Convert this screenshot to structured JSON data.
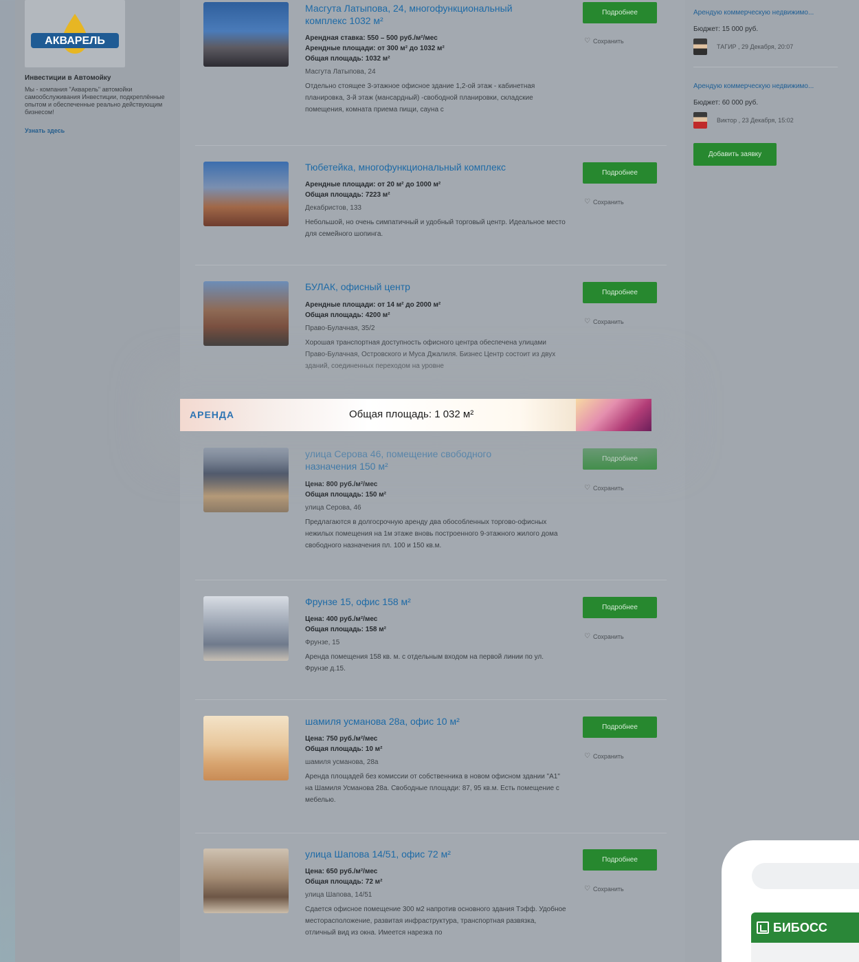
{
  "sidebar": {
    "logo_text": "АКВАРЕЛЬ",
    "promo_title": "Инвестиции в Автомойку",
    "promo_text": "Мы - компания \"Акварель\" автомойки самообслуживания Инвестиции, подкреплённые опытом и обеспеченные реально действующим бизнесом!",
    "promo_link": "Узнать здесь"
  },
  "listings": [
    {
      "title": "Масгута Латыпова, 24, многофункциональный комплекс 1032 м²",
      "facts": [
        "Арендная ставка: 550 – 500 руб./м²/мес",
        "Арендные площади: от 300 м² до 1032 м²",
        "Общая площадь: 1032 м²"
      ],
      "address": "Масгута Латыпова, 24",
      "description": "Отдельно стоящее 3-этажное офисное здание 1,2-ой этаж - кабинетная планировка, 3-й этаж (мансардный) -свободной планировки, складские помещения, комната приема пищи, сауна с",
      "button": "Подробнее",
      "save": "Сохранить"
    },
    {
      "title": "Тюбетейка, многофункциональный комплекс",
      "facts": [
        "Арендные площади: от 20 м² до 1000 м²",
        "Общая площадь: 7223 м²"
      ],
      "address": "Декабристов, 133",
      "description": "Небольшой, но очень симпатичный и удобный торговый центр. Идеальное место для семейного шопинга.",
      "button": "Подробнее",
      "save": "Сохранить"
    },
    {
      "title": "БУЛАК, офисный центр",
      "facts": [
        "Арендные площади: от 14 м² до 2000 м²",
        "Общая площадь: 4200 м²"
      ],
      "address": "Право-Булачная, 35/2",
      "description": "Хорошая транспортная доступность офисного центра обеспечена улицами Право-Булачная, Островского и Муса Джалиля. Бизнес Центр состоит из двух зданий, соединенных переходом на уровне",
      "button": "Подробнее",
      "save": "Сохранить"
    },
    {
      "title": "улица Серова 46, помещение свободного назначения 150 м²",
      "facts": [
        "Цена: 800 руб./м²/мес",
        "Общая площадь: 150 м²"
      ],
      "address": "улица Серова, 46",
      "description": "Предлагаются в долгосрочную аренду два обособленных торгово-офисных нежилых помещения на 1м этаже вновь построенного 9-этажного жилого дома свободного назначения пл. 100 и 150 кв.м.",
      "button": "Подробнее",
      "save": "Сохранить"
    },
    {
      "title": "Фрунзе 15, офис 158 м²",
      "facts": [
        "Цена: 400 руб./м²/мес",
        "Общая площадь: 158 м²"
      ],
      "address": "Фрунзе, 15",
      "description": "Аренда помещения 158 кв. м. с отдельным входом на первой линии по ул. Фрунзе д.15.",
      "button": "Подробнее",
      "save": "Сохранить"
    },
    {
      "title": "шамиля усманова 28а, офис 10 м²",
      "facts": [
        "Цена: 750 руб./м²/мес",
        "Общая площадь: 10 м²"
      ],
      "address": "шамиля усманова, 28а",
      "description": "Аренда площадей без комиссии от собственника в новом офисном здании \"А1\" на Шамиля Усманова 28а. Свободные площади: 87, 95 кв.м. Есть помещение с мебелью.",
      "button": "Подробнее",
      "save": "Сохранить"
    },
    {
      "title": "улица Шапова 14/51, офис 72 м²",
      "facts": [
        "Цена: 650 руб./м²/мес",
        "Общая площадь: 72 м²"
      ],
      "address": "улица Шапова, 14/51",
      "description": "Сдается офисное помещение 300 м2 напротив основного здания Тэфф. Удобное месторасположение, развитая инфраструктура, транспортная развязка, отличный вид из окна. Имеется нарезка по",
      "button": "Подробнее",
      "save": "Сохранить"
    }
  ],
  "banner": {
    "tag": "АРЕНДА",
    "text": "Общая площадь: 1 032 м²"
  },
  "requests": [
    {
      "title": "Арендую коммерческую недвижимо...",
      "budget": "Бюджет: 15 000 руб.",
      "meta": "ТАГИР , 29 Декабря, 20:07"
    },
    {
      "title": "Арендую коммерческую недвижимо...",
      "budget": "Бюджет: 60 000 руб.",
      "meta": "Виктор , 23 Декабря, 15:02"
    }
  ],
  "add_request_button": "Добавить заявку",
  "phone": {
    "brand": "БИБОСС"
  },
  "colors": {
    "accent_green": "#27882f",
    "link_blue": "#1d6aa6"
  }
}
